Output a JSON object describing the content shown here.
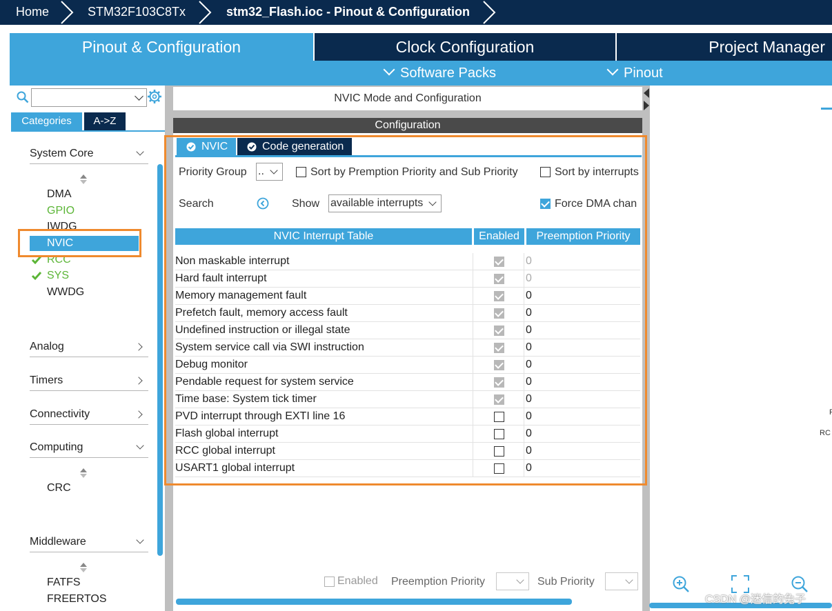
{
  "breadcrumb": {
    "home": "Home",
    "device": "STM32F103C8Tx",
    "file": "stm32_Flash.ioc - Pinout & Configuration"
  },
  "main_tabs": {
    "pinout": "Pinout & Configuration",
    "clock": "Clock Configuration",
    "project": "Project Manager"
  },
  "subnav": {
    "software_packs": "Software Packs",
    "pinout": "Pinout"
  },
  "left": {
    "search_value": "",
    "tab_categories": "Categories",
    "tab_az": "A->Z",
    "system_core": "System Core",
    "system_core_items": [
      "DMA",
      "GPIO",
      "IWDG",
      "NVIC",
      "RCC",
      "SYS",
      "WWDG"
    ],
    "analog": "Analog",
    "timers": "Timers",
    "connectivity": "Connectivity",
    "computing": "Computing",
    "computing_items": [
      "CRC"
    ],
    "middleware": "Middleware",
    "middleware_items": [
      "FATFS",
      "FREERTOS"
    ]
  },
  "center": {
    "header": "NVIC Mode and Configuration",
    "config_bar": "Configuration",
    "tab_nvic": "NVIC",
    "tab_codegen": "Code generation",
    "priority_group_label": "Priority Group",
    "priority_group_value": "..",
    "sort_premption": "Sort by Premption Priority and Sub Priority",
    "sort_interrupts": "Sort by interrupts",
    "search_label": "Search",
    "show_label": "Show",
    "show_value": "available interrupts",
    "force_dma": "Force DMA chan",
    "table": {
      "col_name": "NVIC Interrupt Table",
      "col_enabled": "Enabled",
      "col_preemption": "Preemption Priority",
      "rows": [
        {
          "name": "Non maskable interrupt",
          "enabled": true,
          "locked": true,
          "priority": "0"
        },
        {
          "name": "Hard fault interrupt",
          "enabled": true,
          "locked": true,
          "priority": "0"
        },
        {
          "name": "Memory management fault",
          "enabled": true,
          "locked": true,
          "priority": "0"
        },
        {
          "name": "Prefetch fault, memory access fault",
          "enabled": true,
          "locked": true,
          "priority": "0"
        },
        {
          "name": "Undefined instruction or illegal state",
          "enabled": true,
          "locked": true,
          "priority": "0"
        },
        {
          "name": "System service call via SWI instruction",
          "enabled": true,
          "locked": true,
          "priority": "0"
        },
        {
          "name": "Debug monitor",
          "enabled": true,
          "locked": true,
          "priority": "0"
        },
        {
          "name": "Pendable request for system service",
          "enabled": true,
          "locked": true,
          "priority": "0"
        },
        {
          "name": "Time base: System tick timer",
          "enabled": true,
          "locked": true,
          "priority": "0"
        },
        {
          "name": "PVD interrupt through EXTI line 16",
          "enabled": false,
          "locked": false,
          "priority": "0"
        },
        {
          "name": "Flash global interrupt",
          "enabled": false,
          "locked": false,
          "priority": "0"
        },
        {
          "name": "RCC global interrupt",
          "enabled": false,
          "locked": false,
          "priority": "0"
        },
        {
          "name": "USART1 global interrupt",
          "enabled": false,
          "locked": false,
          "priority": "0"
        }
      ]
    },
    "bottom": {
      "enabled": "Enabled",
      "preemption": "Preemption Priority",
      "sub": "Sub Priority"
    }
  },
  "right": {
    "text_r": "R",
    "text_rc": "RC"
  },
  "watermark": "CSDN @迷信的兔子",
  "colors": {
    "navy": "#0a2a4e",
    "accent": "#3ea5db",
    "highlight": "#ef8a2e",
    "green": "#5bb536"
  }
}
